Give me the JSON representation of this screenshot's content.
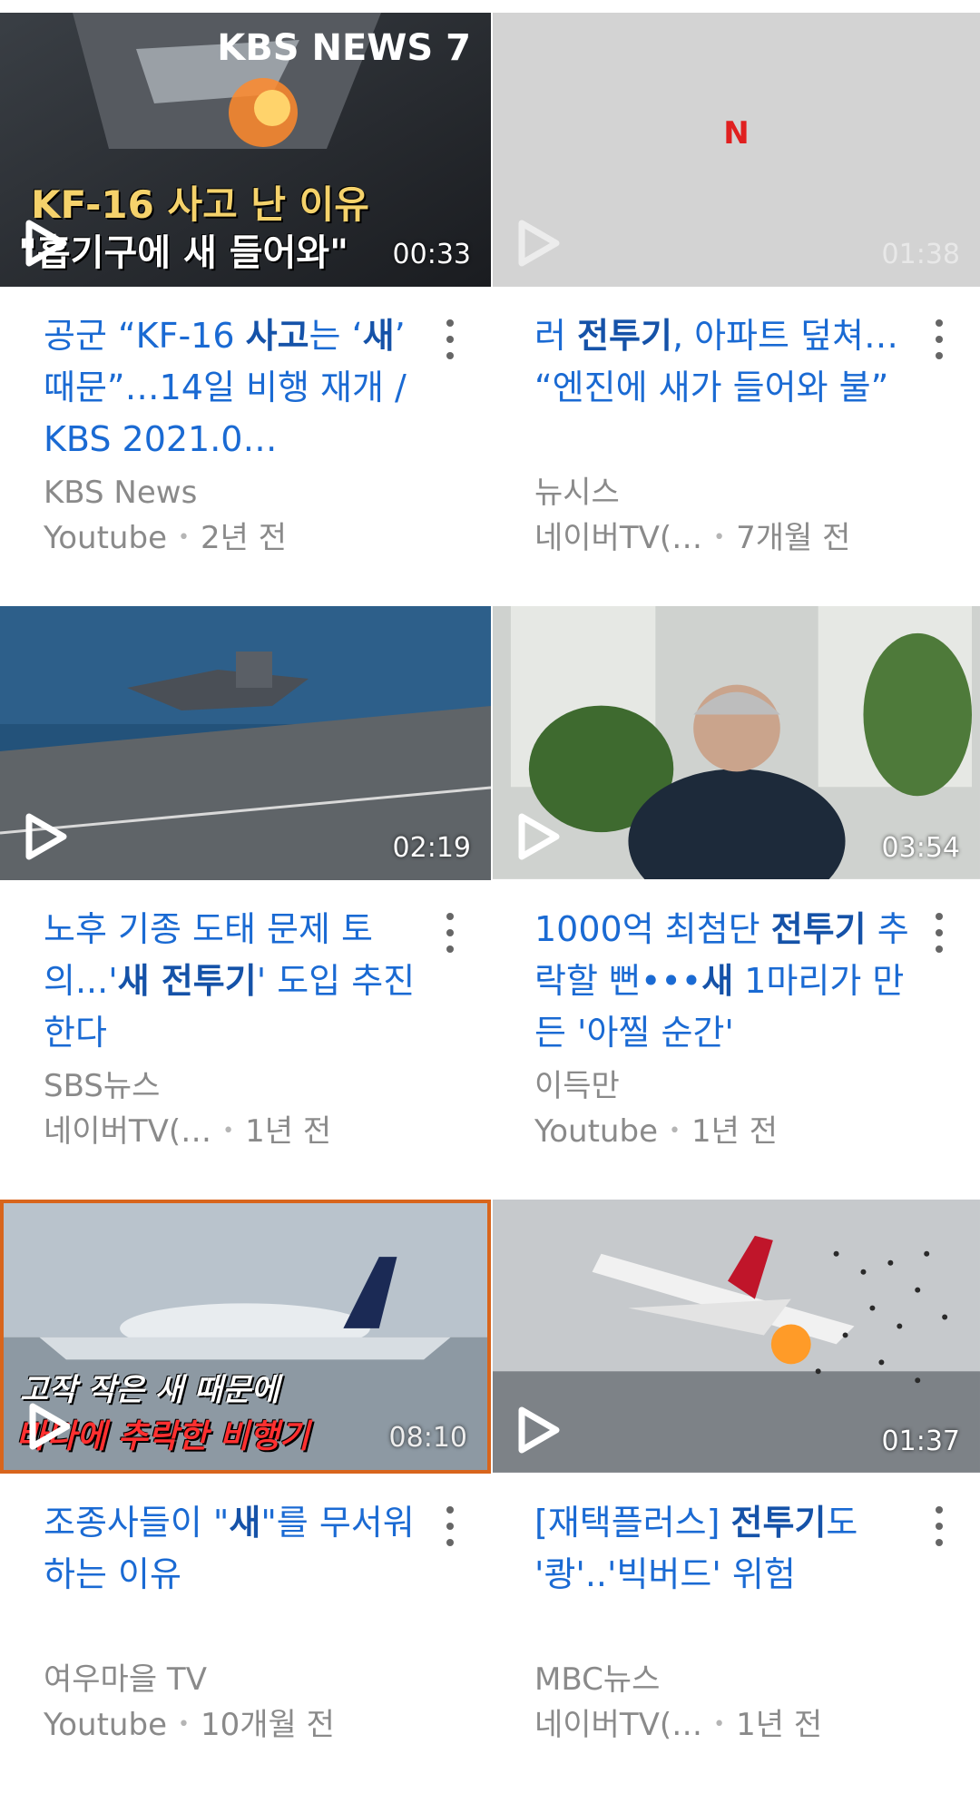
{
  "videos": [
    {
      "thumb_text": [
        "KF-16 사고 난 이유",
        "\"흡기구에 새 들어와\""
      ],
      "thumb_logo": "KBS NEWS 7",
      "duration": "00:33",
      "title_parts": [
        {
          "t": "공군 “KF-16 ",
          "b": false
        },
        {
          "t": "사고",
          "b": true
        },
        {
          "t": "는 ‘",
          "b": false
        },
        {
          "t": "새",
          "b": true
        },
        {
          "t": "’ 때문”…14일 비행 재개 / KBS 2021.0…",
          "b": false
        }
      ],
      "channel": "KBS News",
      "source": "Youtube",
      "age": "2년 전"
    },
    {
      "thumb_text": [],
      "thumb_logo": "N",
      "duration": "01:38",
      "title_parts": [
        {
          "t": "러 ",
          "b": false
        },
        {
          "t": "전투기",
          "b": true
        },
        {
          "t": ", 아파트 덮쳐… “엔진에 새가 들어와 불”",
          "b": false
        }
      ],
      "channel": "뉴시스",
      "source": "네이버TV(…",
      "age": "7개월 전"
    },
    {
      "thumb_text": [],
      "thumb_logo": "",
      "duration": "02:19",
      "title_parts": [
        {
          "t": "노후 기종 도태 문제 토의...'",
          "b": false
        },
        {
          "t": "새 전투기",
          "b": true
        },
        {
          "t": "' 도입 추진한다",
          "b": false
        }
      ],
      "channel": "SBS뉴스",
      "source": "네이버TV(…",
      "age": "1년 전"
    },
    {
      "thumb_text": [],
      "thumb_logo": "",
      "duration": "03:54",
      "title_parts": [
        {
          "t": "1000억 최첨단 ",
          "b": false
        },
        {
          "t": "전투기",
          "b": true
        },
        {
          "t": " 추락할 뻔•••",
          "b": false
        },
        {
          "t": "새",
          "b": true
        },
        {
          "t": " 1마리가 만든 '아찔 순간'",
          "b": false
        }
      ],
      "channel": "이득만",
      "source": "Youtube",
      "age": "1년 전"
    },
    {
      "thumb_text": [
        "고작 작은 새 때문에",
        "바다에 추락한 비행기"
      ],
      "thumb_logo": "",
      "duration": "08:10",
      "title_parts": [
        {
          "t": "조종사들이 \"",
          "b": false
        },
        {
          "t": "새",
          "b": true
        },
        {
          "t": "\"를 무서워하는 이유",
          "b": false
        }
      ],
      "channel": "여우마을 TV",
      "source": "Youtube",
      "age": "10개월 전"
    },
    {
      "thumb_text": [],
      "thumb_logo": "",
      "duration": "01:37",
      "title_parts": [
        {
          "t": "[재택플러스] ",
          "b": false
        },
        {
          "t": "전투기",
          "b": true
        },
        {
          "t": "도 '쾅'..'빅버드' 위험",
          "b": false
        }
      ],
      "channel": "MBC뉴스",
      "source": "네이버TV(…",
      "age": "1년 전"
    }
  ],
  "colors": {
    "title": "#1a6ad3",
    "meta": "#8a8a8a"
  },
  "icons": {
    "play": "play-icon",
    "more": "more-vertical-icon"
  }
}
